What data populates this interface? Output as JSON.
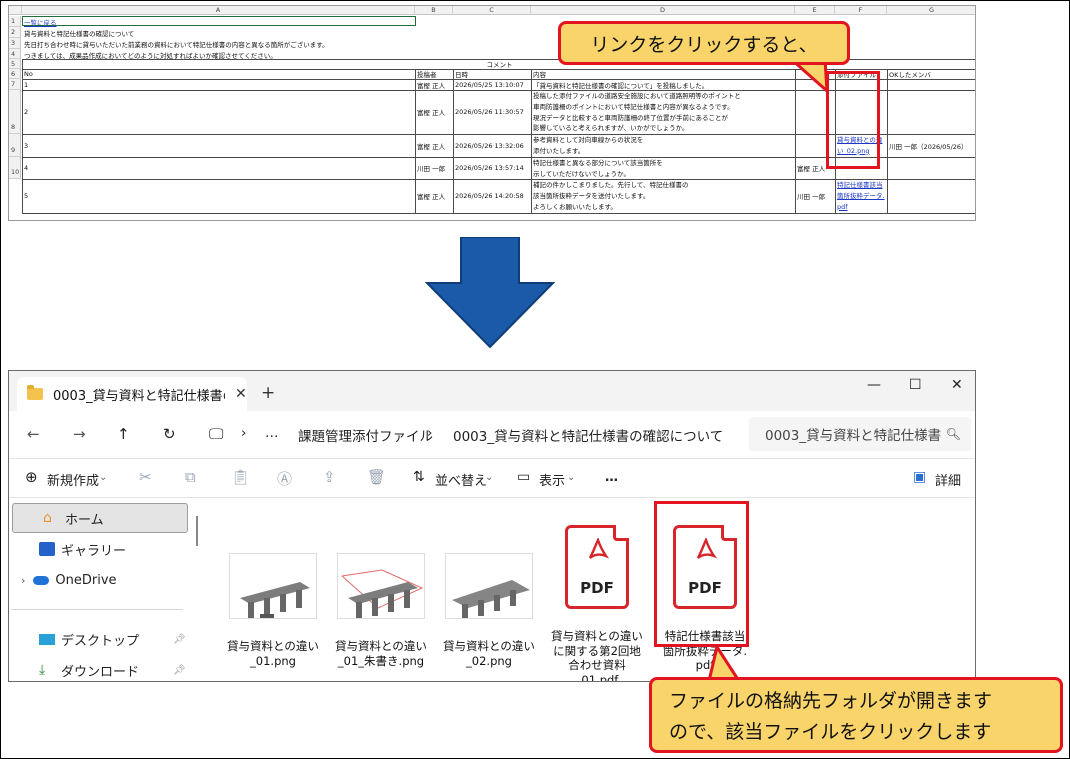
{
  "sheet": {
    "columns": [
      "A",
      "B",
      "C",
      "D",
      "E",
      "F",
      "G"
    ],
    "rows": [
      "1",
      "2",
      "3",
      "4",
      "5",
      "6",
      "7",
      "8",
      "9",
      "10"
    ],
    "a1_link": "一覧に戻る",
    "line2": "貸与資料と特記仕様書の確認について",
    "line3a": "先日打ち合わせ時に貸与いただいた前業務の資料において特記仕様書の内容と異なる箇所がございます。",
    "line3b": "つきましては、成果品作成においてどのように対処すればよいか確認させてください。",
    "comment_title": "コメント",
    "headers": {
      "no": "No",
      "poster": "投稿者",
      "datetime": "日時",
      "content": "内容",
      "attachment": "添付ファイル",
      "ok_members": "OKしたメンバ"
    },
    "records": [
      {
        "no": "1",
        "poster": "富樫 正人",
        "datetime": "2026/05/25 13:10:07",
        "content": "「貸与資料と特記仕様書の確認について」を投稿しました。",
        "e": "",
        "attachment": "",
        "ok": ""
      },
      {
        "no": "2",
        "poster": "富樫 正人",
        "datetime": "2026/05/26 11:30:57",
        "content": "投稿した添付ファイルの道路安全施設において道路照明等のポイントと\n車両防護柵のポイントにおいて特記仕様書と内容が異なるようです。\n現況データと比較すると車両防護柵の終了位置が手前にあることが\n影響していると考えられますが、いかがでしょうか。",
        "e": "",
        "attachment": "",
        "ok": ""
      },
      {
        "no": "3",
        "poster": "富樫 正人",
        "datetime": "2026/05/26 13:32:06",
        "content": "参考資料として対向車線からの状況を\n添付いたします。",
        "e": "",
        "attachment": "貸与資料との違い_02.png",
        "ok": "川田 一郎（2026/05/26）"
      },
      {
        "no": "4",
        "poster": "川田 一郎",
        "datetime": "2026/05/26 13:57:14",
        "content": "特記仕様書と異なる部分について該当箇所を\n示していただけないでしょうか。",
        "e": "富樫 正人",
        "attachment": "",
        "ok": ""
      },
      {
        "no": "5",
        "poster": "富樫 正人",
        "datetime": "2026/05/26 14:20:58",
        "content": "補記の件かしこまりました。先行して、特記仕様書の\n該当箇所抜粋データを送付いたします。\nよろしくお願いいたします。",
        "e": "川田 一郎",
        "attachment": "特記仕様書該当箇所抜粋データ.pdf",
        "ok": ""
      }
    ]
  },
  "callouts": {
    "top": "リンクをクリックすると、",
    "bottom_line1": "ファイルの格納先フォルダが開きます",
    "bottom_line2": "ので、該当ファイルをクリックします"
  },
  "explorer": {
    "tab_title": "0003_貸与資料と特記仕様書の確",
    "new_tab": "+",
    "breadcrumb": [
      "課題管理添付ファイル",
      "0003_貸与資料と特記仕様書の確認について"
    ],
    "breadcrumb_more": "…",
    "search_placeholder": "0003_貸与資料と特記仕様書",
    "toolbar": {
      "new": "新規作成",
      "sort": "並べ替え",
      "view": "表示",
      "more": "…",
      "details": "詳細"
    },
    "sidebar": [
      {
        "label": "ホーム",
        "icon": "home-icon"
      },
      {
        "label": "ギャラリー",
        "icon": "gallery-icon"
      },
      {
        "label": "OneDrive",
        "icon": "onedrive-icon"
      },
      {
        "label": "デスクトップ",
        "icon": "desktop-icon"
      },
      {
        "label": "ダウンロード",
        "icon": "download-icon"
      }
    ],
    "files": [
      {
        "name": "貸与資料との違い\n_01.png",
        "kind": "image"
      },
      {
        "name": "貸与資料との違い\n_01_朱書き.png",
        "kind": "image"
      },
      {
        "name": "貸与資料との違い\n_02.png",
        "kind": "image"
      },
      {
        "name": "貸与資料との違い\nに関する第2回地\n合わせ資料\n_01.pdf",
        "kind": "pdf"
      },
      {
        "name": "特記仕様書該当\n箇所抜粋データ.\npdf",
        "kind": "pdf"
      }
    ],
    "pdf_badge": "PDF"
  },
  "colors": {
    "callout_fill": "#f9d46a",
    "callout_border": "#e1141f",
    "arrow": "#1a5aa8",
    "link": "#1b38c7",
    "pdf_red": "#d7262b"
  }
}
